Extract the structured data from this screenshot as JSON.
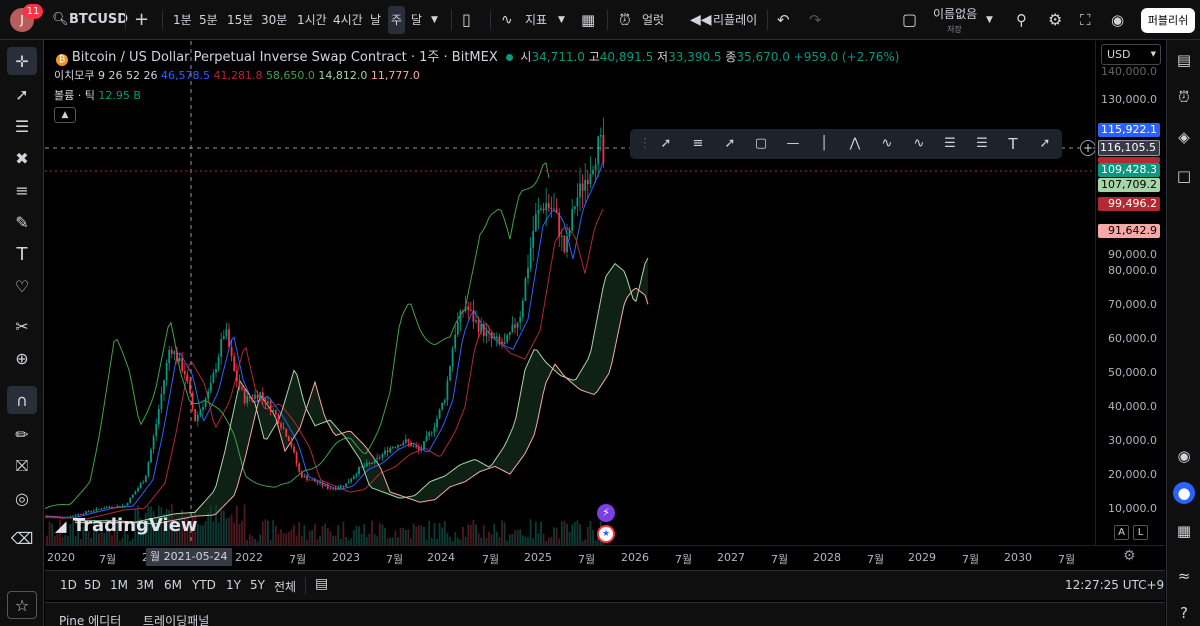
{
  "topbar": {
    "avatar_initial": "J",
    "notifications": "11",
    "symbol": "BTCUSD",
    "add_symbol": "+",
    "intervals": [
      "1분",
      "5분",
      "15분",
      "30분",
      "1시간",
      "4시간",
      "날",
      "주",
      "달"
    ],
    "active_interval": "주",
    "indicators_label": "지표",
    "alert_label": "얼럿",
    "replay_label": "리플레이",
    "layout_name": "이름없음",
    "layout_status": "저장",
    "publish_label": "퍼블리쉬"
  },
  "chart": {
    "title": "Bitcoin / US Dollar Perpetual Inverse Swap Contract · 1주 · BitMEX",
    "ohlc": {
      "open_label": "시",
      "open": "34,711.0",
      "high_label": "고",
      "high": "40,891.5",
      "low_label": "저",
      "low": "33,390.5",
      "close_label": "종",
      "close": "35,670.0",
      "change": "+959.0 (+2.76%)"
    },
    "ichimoku": {
      "label": "이치모쿠 9 26 52 26",
      "v1": "46,578.5",
      "v2": "41,281.8",
      "v3": "58,650.0",
      "v4": "14,812.0",
      "v5": "11,777.0"
    },
    "volume": {
      "label": "볼륨 · 틱",
      "value": "12.95 B"
    },
    "currency": "USD",
    "watermark": "TradingView",
    "crosshair_date": "2021-05-24",
    "crosshair_month_partial": "월"
  },
  "price_axis": {
    "labels": [
      "130,000.0",
      "90,000.0",
      "80,000.0",
      "70,000.0",
      "60,000.0",
      "50,000.0",
      "40,000.0",
      "30,000.0",
      "20,000.0",
      "10,000.0"
    ],
    "top_partial": "140,000.0",
    "badges": [
      {
        "value": "115,922.1",
        "color": "#2962ff"
      },
      {
        "value": "116,105.5",
        "color": "#363a45"
      },
      {
        "value": "109,428.3",
        "color": "#089981"
      },
      {
        "value": "107,709.2",
        "color": "#a5d6a7"
      },
      {
        "value": "99,496.2",
        "color": "#b22833"
      },
      {
        "value": "91,642.9",
        "color": "#f7a9a7"
      }
    ],
    "auto_label": "A",
    "log_label": "L"
  },
  "time_axis": {
    "labels": [
      "2020",
      "7월",
      "2",
      "2022",
      "7월",
      "2023",
      "7월",
      "2024",
      "7월",
      "2025",
      "7월",
      "2026",
      "7월",
      "2027",
      "7월",
      "2028",
      "7월",
      "2029",
      "7월",
      "2030",
      "7월"
    ]
  },
  "range_bar": {
    "ranges": [
      "1D",
      "5D",
      "1M",
      "3M",
      "6M",
      "YTD",
      "1Y",
      "5Y",
      "전체"
    ],
    "clock": "12:27:25 UTC+9"
  },
  "bottom_panels": {
    "tabs": [
      "Pine 에디터",
      "트레이딩패널"
    ]
  },
  "colors": {
    "up": "#089981",
    "down": "#f23645",
    "background": "#000000",
    "accent": "#2962ff"
  }
}
